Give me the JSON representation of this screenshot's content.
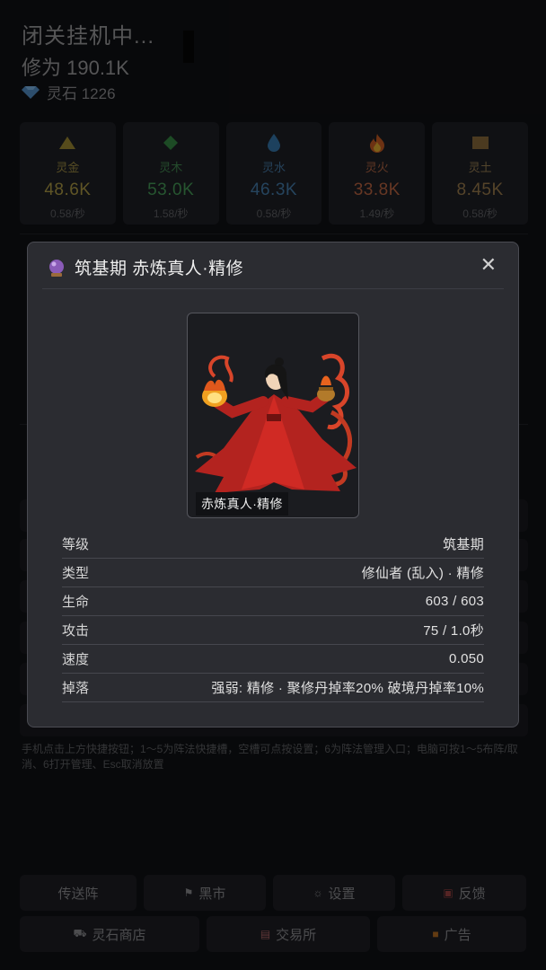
{
  "header": {
    "status": "闭关挂机中...",
    "cultivation": "修为 190.1K",
    "spirit_stone": "灵石 1226"
  },
  "resources": [
    {
      "name": "灵金",
      "value": "48.6K",
      "rate": "0.58/秒",
      "color": "#9a8a3e",
      "icon": "triangle-icon"
    },
    {
      "name": "灵木",
      "value": "53.0K",
      "rate": "1.58/秒",
      "color": "#3e8a4e",
      "icon": "diamond-icon"
    },
    {
      "name": "灵水",
      "value": "46.3K",
      "rate": "0.58/秒",
      "color": "#3d6f98",
      "icon": "water-drop-icon"
    },
    {
      "name": "灵火",
      "value": "33.8K",
      "rate": "1.49/秒",
      "color": "#a65a3a",
      "icon": "fire-icon"
    },
    {
      "name": "灵土",
      "value": "8.45K",
      "rate": "0.58/秒",
      "color": "#8a6e44",
      "icon": "square-icon"
    }
  ],
  "help_text": "手机点击上方快捷按钮；1～5为阵法快捷槽，空槽可点按设置；6为阵法管理入口；电脑可按1～5布阵/取消、6打开管理、Esc取消放置",
  "buttons_row1": [
    "传送阵",
    "黑市",
    "设置",
    "反馈"
  ],
  "buttons_row2": [
    "灵石商店",
    "交易所",
    "广告"
  ],
  "modal": {
    "title": "筑基期 赤炼真人·精修",
    "close": "✕",
    "portrait_caption": "赤炼真人·精修",
    "stats": [
      {
        "label": "等级",
        "value": "筑基期"
      },
      {
        "label": "类型",
        "value": "修仙者 (乱入) · 精修"
      },
      {
        "label": "生命",
        "value": "603 / 603"
      },
      {
        "label": "攻击",
        "value": "75 / 1.0秒"
      },
      {
        "label": "速度",
        "value": "0.050"
      },
      {
        "label": "掉落",
        "value": "强弱: 精修 · 聚修丹掉率20% 破境丹掉率10%"
      }
    ]
  }
}
